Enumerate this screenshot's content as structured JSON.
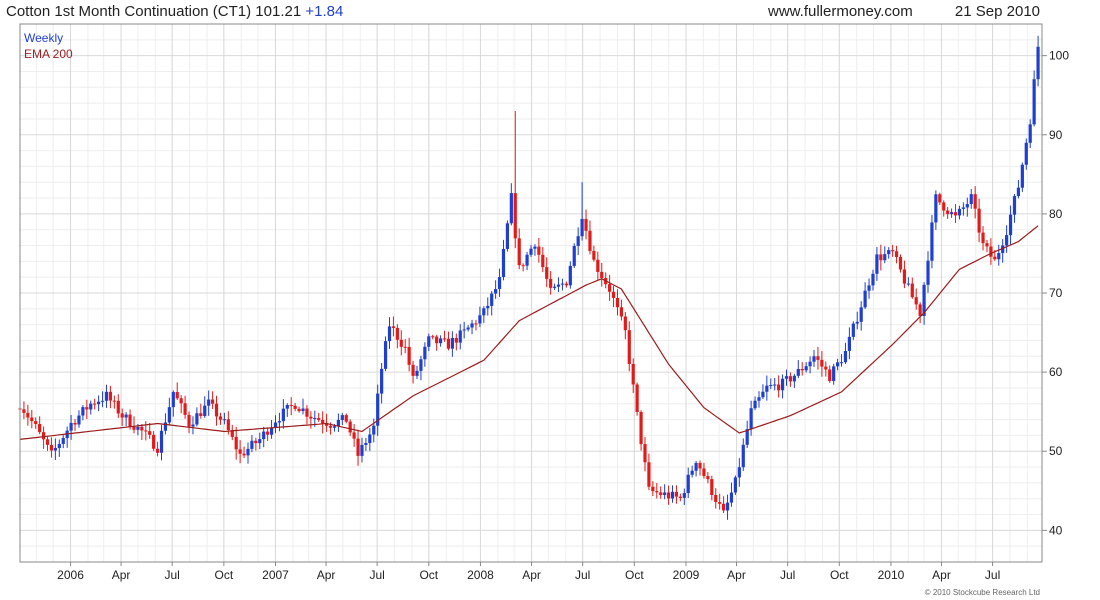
{
  "header": {
    "title": "Cotton 1st Month Continuation (CT1)",
    "price": "101.21",
    "change": "+1.84",
    "website": "www.fullermoney.com",
    "date": "21 Sep 2010"
  },
  "legend": {
    "weekly": "Weekly",
    "ema": "EMA 200"
  },
  "copyright": "© 2010 Stockcube Research Ltd",
  "colors": {
    "up": "#1f3fd0",
    "down": "#e31a1a",
    "ema": "#9b1b1b",
    "grid": "#d9d9d9"
  },
  "chart_data": {
    "type": "candlestick",
    "interval": "weekly",
    "y_axis_side": "right",
    "ylim": [
      36,
      104
    ],
    "yticks": [
      40,
      50,
      60,
      70,
      80,
      90,
      100
    ],
    "xlim": [
      "2005-10-03",
      "2010-09-27"
    ],
    "x_tick_labels": [
      {
        "date": "2006-01-01",
        "label": "2006"
      },
      {
        "date": "2006-04-01",
        "label": "Apr"
      },
      {
        "date": "2006-07-01",
        "label": "Jul"
      },
      {
        "date": "2006-10-01",
        "label": "Oct"
      },
      {
        "date": "2007-01-01",
        "label": "2007"
      },
      {
        "date": "2007-04-01",
        "label": "Apr"
      },
      {
        "date": "2007-07-01",
        "label": "Jul"
      },
      {
        "date": "2007-10-01",
        "label": "Oct"
      },
      {
        "date": "2008-01-01",
        "label": "2008"
      },
      {
        "date": "2008-04-01",
        "label": "Apr"
      },
      {
        "date": "2008-07-01",
        "label": "Jul"
      },
      {
        "date": "2008-10-01",
        "label": "Oct"
      },
      {
        "date": "2009-01-01",
        "label": "2009"
      },
      {
        "date": "2009-04-01",
        "label": "Apr"
      },
      {
        "date": "2009-07-01",
        "label": "Jul"
      },
      {
        "date": "2009-10-01",
        "label": "Oct"
      },
      {
        "date": "2010-01-01",
        "label": "2010"
      },
      {
        "date": "2010-04-01",
        "label": "Apr"
      },
      {
        "date": "2010-07-01",
        "label": "Jul"
      }
    ],
    "close_anchors": [
      [
        "2005-10-03",
        56.0
      ],
      [
        "2005-10-31",
        53.0
      ],
      [
        "2005-11-28",
        49.5
      ],
      [
        "2006-01-02",
        53.5
      ],
      [
        "2006-02-06",
        56.0
      ],
      [
        "2006-03-06",
        57.0
      ],
      [
        "2006-04-03",
        54.5
      ],
      [
        "2006-05-08",
        52.5
      ],
      [
        "2006-06-05",
        50.5
      ],
      [
        "2006-07-03",
        57.5
      ],
      [
        "2006-07-31",
        53.5
      ],
      [
        "2006-09-04",
        56.0
      ],
      [
        "2006-10-02",
        53.5
      ],
      [
        "2006-10-30",
        49.5
      ],
      [
        "2006-12-04",
        51.5
      ],
      [
        "2007-01-01",
        54.0
      ],
      [
        "2007-02-05",
        56.0
      ],
      [
        "2007-03-05",
        54.5
      ],
      [
        "2007-04-09",
        53.5
      ],
      [
        "2007-05-07",
        54.0
      ],
      [
        "2007-05-28",
        49.5
      ],
      [
        "2007-06-25",
        53.0
      ],
      [
        "2007-07-09",
        60.5
      ],
      [
        "2007-07-23",
        66.0
      ],
      [
        "2007-08-20",
        63.0
      ],
      [
        "2007-09-03",
        59.0
      ],
      [
        "2007-10-01",
        64.0
      ],
      [
        "2007-11-05",
        63.5
      ],
      [
        "2007-12-03",
        65.0
      ],
      [
        "2008-01-07",
        67.5
      ],
      [
        "2008-02-04",
        71.5
      ],
      [
        "2008-02-25",
        82.0
      ],
      [
        "2008-03-10",
        73.0
      ],
      [
        "2008-04-07",
        76.5
      ],
      [
        "2008-05-05",
        70.0
      ],
      [
        "2008-06-02",
        71.5
      ],
      [
        "2008-06-30",
        80.0
      ],
      [
        "2008-07-21",
        74.0
      ],
      [
        "2008-08-18",
        70.5
      ],
      [
        "2008-09-15",
        65.0
      ],
      [
        "2008-10-06",
        54.5
      ],
      [
        "2008-10-27",
        45.0
      ],
      [
        "2008-11-24",
        44.5
      ],
      [
        "2008-12-22",
        44.0
      ],
      [
        "2009-01-19",
        49.0
      ],
      [
        "2009-02-16",
        45.0
      ],
      [
        "2009-03-09",
        42.0
      ],
      [
        "2009-03-30",
        46.0
      ],
      [
        "2009-04-27",
        55.0
      ],
      [
        "2009-05-25",
        58.0
      ],
      [
        "2009-06-22",
        58.5
      ],
      [
        "2009-07-20",
        60.0
      ],
      [
        "2009-08-17",
        62.0
      ],
      [
        "2009-09-14",
        59.5
      ],
      [
        "2009-10-12",
        62.5
      ],
      [
        "2009-11-09",
        68.5
      ],
      [
        "2009-12-07",
        74.5
      ],
      [
        "2010-01-04",
        75.0
      ],
      [
        "2010-02-01",
        70.5
      ],
      [
        "2010-02-22",
        67.5
      ],
      [
        "2010-03-22",
        82.0
      ],
      [
        "2010-04-26",
        79.5
      ],
      [
        "2010-05-24",
        82.0
      ],
      [
        "2010-06-14",
        76.0
      ],
      [
        "2010-07-05",
        74.0
      ],
      [
        "2010-07-26",
        78.0
      ],
      [
        "2010-08-16",
        83.5
      ],
      [
        "2010-09-06",
        92.0
      ],
      [
        "2010-09-20",
        101.2
      ]
    ],
    "ema_anchors": [
      [
        "2005-10-03",
        51.5
      ],
      [
        "2006-06-05",
        53.5
      ],
      [
        "2006-10-02",
        52.5
      ],
      [
        "2007-04-02",
        53.5
      ],
      [
        "2007-06-04",
        52.5
      ],
      [
        "2007-09-03",
        57.0
      ],
      [
        "2008-01-07",
        61.5
      ],
      [
        "2008-03-10",
        66.5
      ],
      [
        "2008-07-07",
        71.0
      ],
      [
        "2008-08-04",
        71.8
      ],
      [
        "2008-09-08",
        70.5
      ],
      [
        "2008-12-01",
        61.0
      ],
      [
        "2009-02-02",
        55.5
      ],
      [
        "2009-04-06",
        52.3
      ],
      [
        "2009-07-06",
        54.5
      ],
      [
        "2009-10-05",
        57.5
      ],
      [
        "2010-01-04",
        63.5
      ],
      [
        "2010-03-01",
        67.5
      ],
      [
        "2010-05-03",
        73.0
      ],
      [
        "2010-06-28",
        75.0
      ],
      [
        "2010-08-16",
        76.5
      ],
      [
        "2010-09-20",
        78.5
      ]
    ],
    "spikes": [
      [
        "2008-03-03",
        93.0
      ],
      [
        "2008-06-30",
        84.0
      ],
      [
        "2010-09-20",
        102.5
      ]
    ]
  }
}
